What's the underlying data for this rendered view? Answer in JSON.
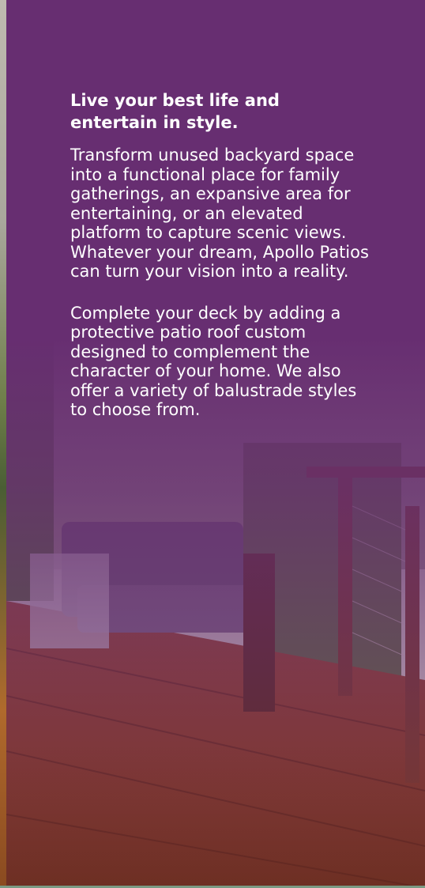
{
  "panel": {
    "heading": "Live your best life and entertain in style.",
    "paragraphs": [
      "Transform unused backyard space into a functional place for family gatherings, an expansive area for entertaining, or an elevated platform to capture scenic views. Whatever your dream, Apollo Patios can turn your vision into a reality.",
      "Complete your deck by adding a protective patio roof custom designed to complement the character of your home. We also offer a variety of balustrade styles to choose from."
    ]
  },
  "colors": {
    "overlay": "#672e71",
    "text": "#ffffff",
    "deck_wood": "#8a3f22"
  }
}
